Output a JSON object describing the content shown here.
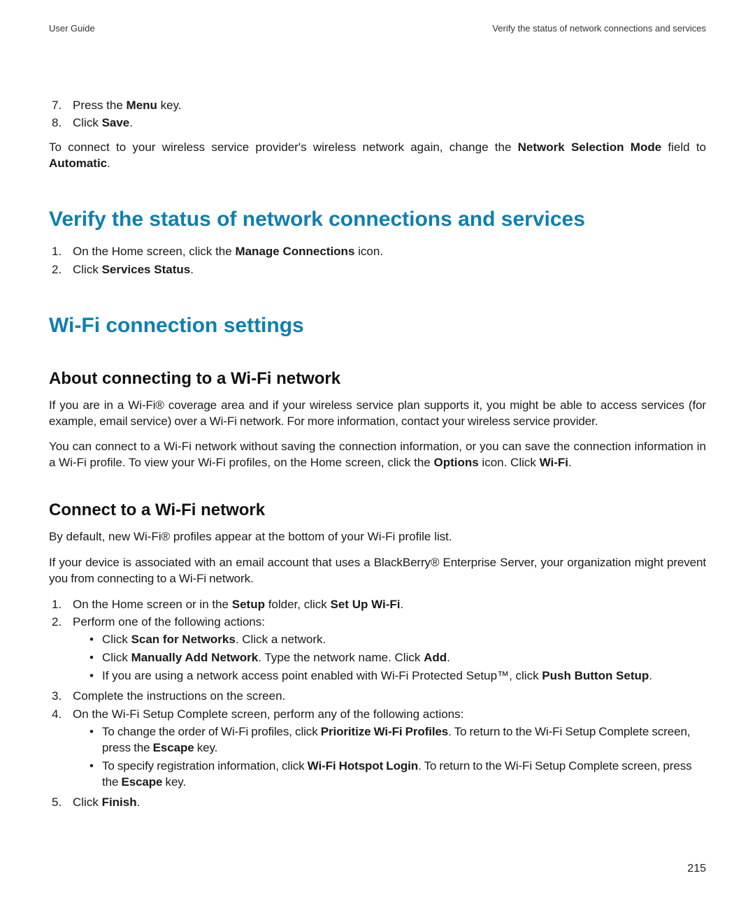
{
  "header": {
    "left": "User Guide",
    "right": "Verify the status of network connections and services"
  },
  "topList": {
    "item7": {
      "num": "7.",
      "pre": "Press the ",
      "bold": "Menu",
      "post": " key."
    },
    "item8": {
      "num": "8.",
      "pre": "Click ",
      "bold": "Save",
      "post": "."
    }
  },
  "topNote": {
    "pre": "To connect to your wireless service provider's wireless network again, change the ",
    "bold1": "Network Selection Mode",
    "mid": " field to ",
    "bold2": "Automatic",
    "post": "."
  },
  "h1a": "Verify the status of network connections and services",
  "verifyList": {
    "item1": {
      "num": "1.",
      "pre": "On the Home screen, click the ",
      "bold": "Manage Connections",
      "post": " icon."
    },
    "item2": {
      "num": "2.",
      "pre": "Click ",
      "bold": "Services Status",
      "post": "."
    }
  },
  "h1b": "Wi-Fi connection settings",
  "h2a": "About connecting to a Wi-Fi network",
  "aboutP1": "If you are in a Wi-Fi® coverage area and if your wireless service plan supports it, you might be able to access services (for example, email service) over a Wi-Fi network. For more information, contact your wireless service provider.",
  "aboutP2": {
    "pre": "You can connect to a Wi-Fi network without saving the connection information, or you can save the connection information in a Wi-Fi profile. To view your Wi-Fi profiles, on the Home screen, click the ",
    "bold1": "Options",
    "mid": " icon. Click ",
    "bold2": "Wi-Fi",
    "post": "."
  },
  "h2b": "Connect to a Wi-Fi network",
  "connP1": "By default, new Wi-Fi® profiles appear at the bottom of your Wi-Fi profile list.",
  "connP2": "If your device is associated with an email account that uses a BlackBerry® Enterprise Server, your organization might prevent you from connecting to a Wi-Fi network.",
  "connList": {
    "item1": {
      "num": "1.",
      "pre": "On the Home screen or in the ",
      "bold1": "Setup",
      "mid": " folder, click ",
      "bold2": "Set Up Wi-Fi",
      "post": "."
    },
    "item2": {
      "num": "2.",
      "text": "Perform one of the following actions:"
    },
    "item2b1": {
      "pre": "Click ",
      "bold": "Scan for Networks",
      "post": ". Click a network."
    },
    "item2b2": {
      "pre": "Click ",
      "bold": "Manually Add Network",
      "mid": ". Type the network name. Click ",
      "bold2": "Add",
      "post": "."
    },
    "item2b3": {
      "pre": "If you are using a network access point enabled with Wi-Fi Protected Setup™, click ",
      "bold": "Push Button Setup",
      "post": "."
    },
    "item3": {
      "num": "3.",
      "text": "Complete the instructions on the screen."
    },
    "item4": {
      "num": "4.",
      "text": "On the Wi-Fi Setup Complete screen, perform any of the following actions:"
    },
    "item4b1": {
      "pre": "To change the order of Wi-Fi profiles, click ",
      "bold": "Prioritize Wi-Fi Profiles",
      "mid": ". To return to the Wi-Fi Setup Complete screen, press the ",
      "bold2": "Escape",
      "post": " key."
    },
    "item4b2": {
      "pre": "To specify registration information, click ",
      "bold": "Wi-Fi Hotspot Login",
      "mid": ". To return to the Wi-Fi Setup Complete screen, press the ",
      "bold2": "Escape",
      "post": " key."
    },
    "item5": {
      "num": "5.",
      "pre": "Click ",
      "bold": "Finish",
      "post": "."
    }
  },
  "pageNumber": "215"
}
